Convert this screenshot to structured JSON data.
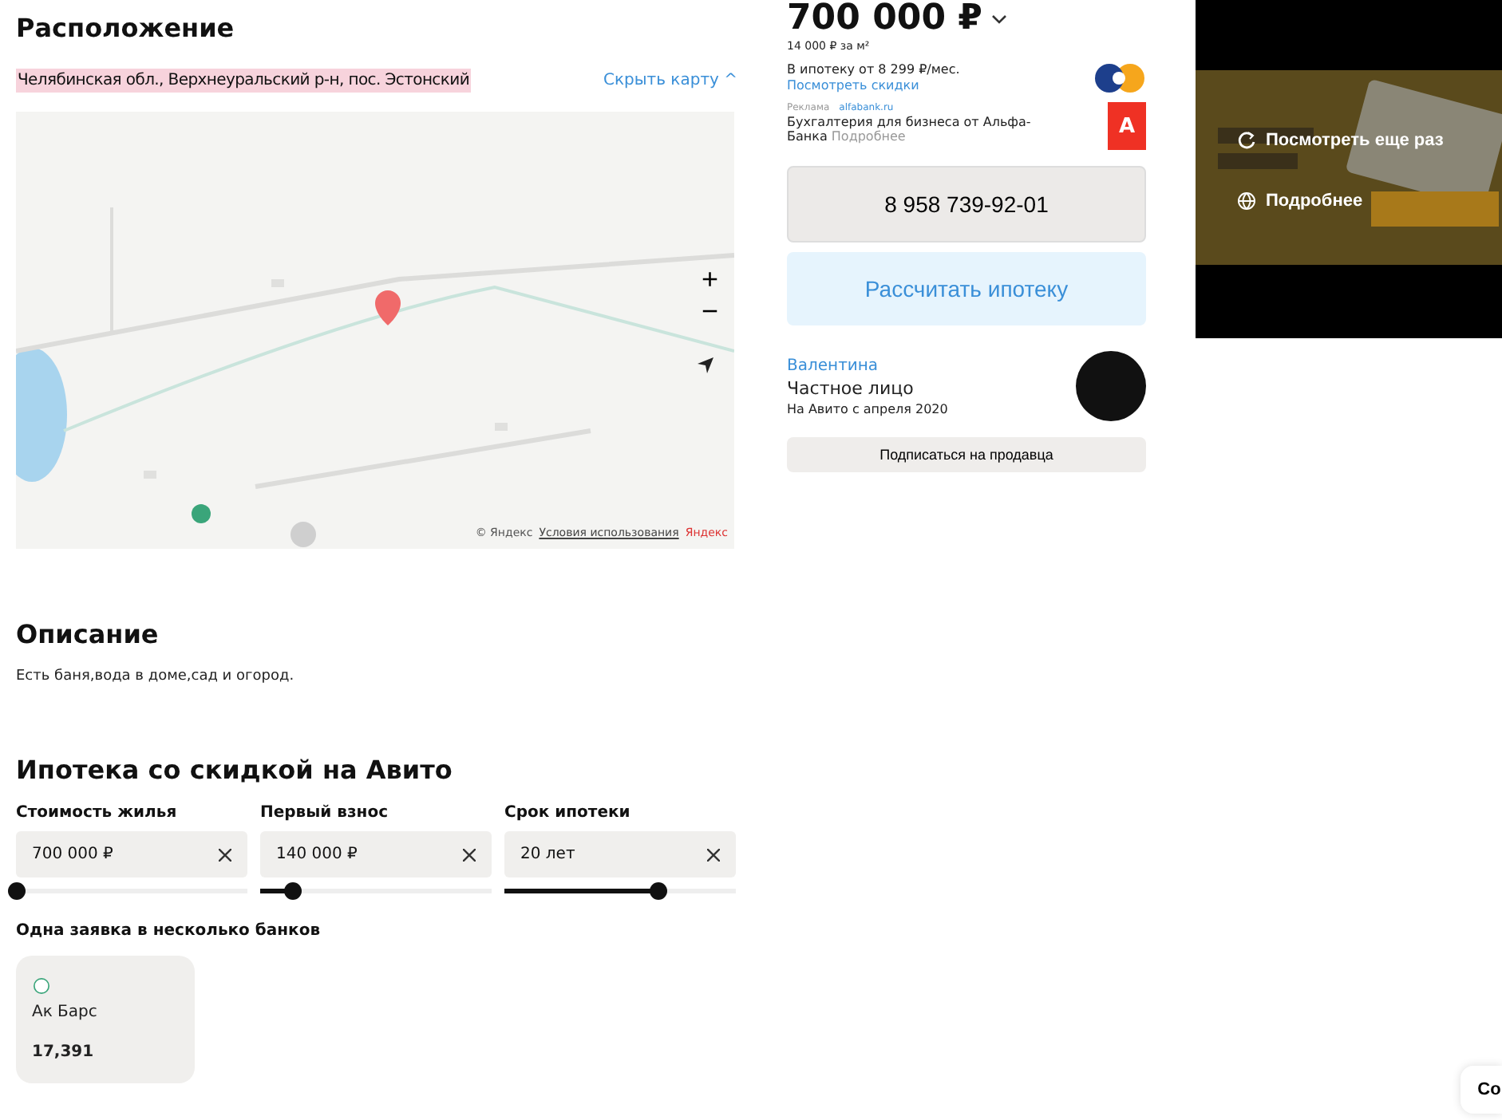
{
  "location": {
    "title": "Расположение",
    "address": "Челябинская обл., Верхнеуральский р-н, пос. Эстонский",
    "toggle": "Скрыть карту ^",
    "map": {
      "kind": "picture",
      "zoom_in": "+",
      "zoom_out": "−",
      "copyright": "© Яндекс",
      "terms": "Условия использования",
      "brand": "Яндекс"
    }
  },
  "offer": {
    "price": "700 000 ₽",
    "price_per_m2": "14 000 ₽ за м²",
    "mortgage": "В ипотеку от 8 299 ₽/мес.",
    "discounts_link": "Посмотреть скидки",
    "ad_label": "Реклама",
    "ad_site": "alfabank.ru",
    "ad_text": "Бухгалтерия для бизнеса от Альфа-Банка",
    "ad_more": "Подробнее",
    "ad_logo": "А",
    "phone": "8 958 739-92-01",
    "calc_button": "Рассчитать ипотеку"
  },
  "seller": {
    "name": "Валентина",
    "type": "Частное лицо",
    "since": "На Авито с апреля 2020",
    "subscribe": "Подписаться на продавца"
  },
  "video_ad": {
    "replay": "Посмотреть еще раз",
    "more": "Подробнее"
  },
  "description": {
    "title": "Описание",
    "text": "Есть баня,вода в доме,сад и огород."
  },
  "mortgage": {
    "title": "Ипотека со скидкой на Авито",
    "fields": [
      {
        "label": "Стоимость жилья",
        "value": "700 000 ₽",
        "level": 0
      },
      {
        "label": "Первый взнос",
        "value": "140 000 ₽",
        "level": 0.14
      },
      {
        "label": "Срок ипотеки",
        "value": "20 лет",
        "level": 0.66
      }
    ],
    "banks_title": "Одна заявка в несколько банков",
    "banks": [
      {
        "name": "Ак Барс",
        "rate": "17,391"
      }
    ]
  },
  "chat_button": "Co"
}
